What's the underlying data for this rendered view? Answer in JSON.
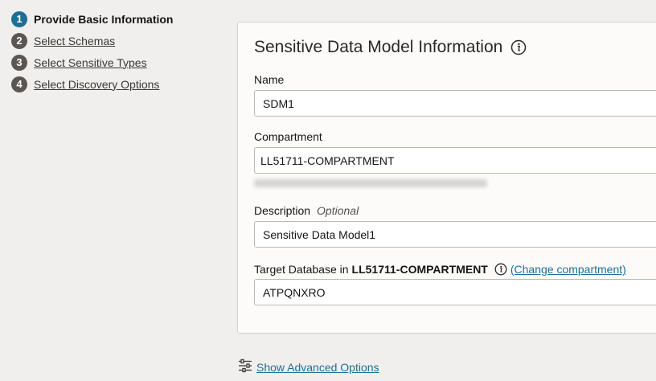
{
  "steps": [
    {
      "number": "1",
      "label": "Provide Basic Information"
    },
    {
      "number": "2",
      "label": "Select Schemas"
    },
    {
      "number": "3",
      "label": "Select Sensitive Types"
    },
    {
      "number": "4",
      "label": "Select Discovery Options"
    }
  ],
  "panel": {
    "title": "Sensitive Data Model Information",
    "name": {
      "label": "Name",
      "value": "SDM1"
    },
    "compartment": {
      "label": "Compartment",
      "value": "LL51711-COMPARTMENT"
    },
    "description": {
      "label": "Description",
      "optional": "Optional",
      "value": "Sensitive Data Model1"
    },
    "target_database": {
      "label_prefix": "Target Database in",
      "compartment_name": "LL51711-COMPARTMENT",
      "change_link": "(Change compartment)",
      "value": "ATPQNXRO"
    }
  },
  "advanced": {
    "link": "Show Advanced Options"
  },
  "colors": {
    "accent": "#1d6f93",
    "step_inactive": "#5b5652",
    "background": "#f1efed"
  }
}
